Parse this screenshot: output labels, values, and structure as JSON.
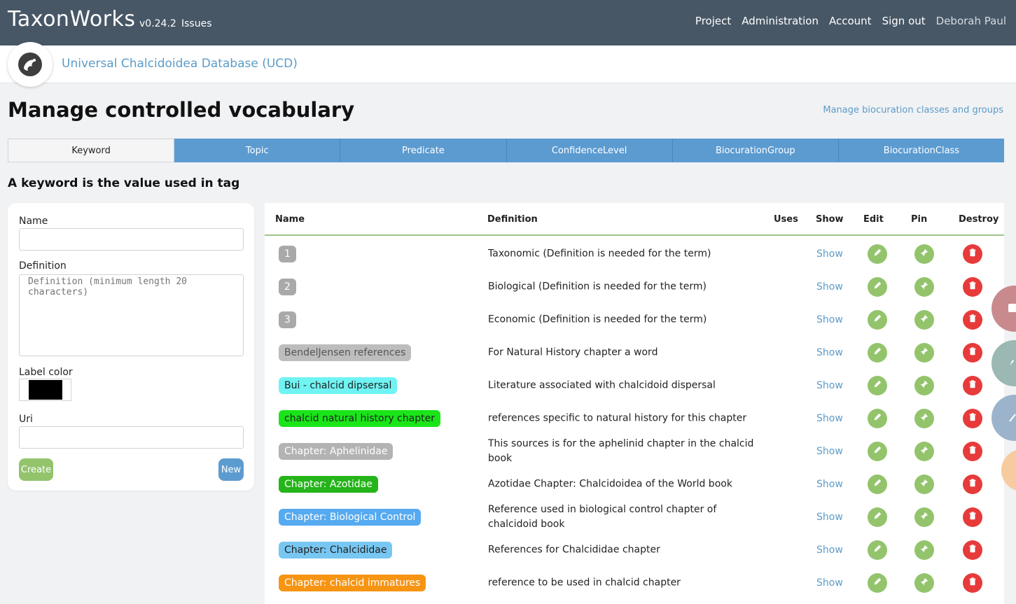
{
  "header": {
    "brand": "TaxonWorks",
    "version": "v0.24.2",
    "issues": "Issues",
    "nav": [
      "Project",
      "Administration",
      "Account",
      "Sign out"
    ],
    "user": "Deborah Paul"
  },
  "project": {
    "name": "Universal Chalcidoidea Database (UCD)"
  },
  "page": {
    "title": "Manage controlled vocabulary",
    "manage_link": "Manage biocuration classes and groups",
    "subtitle": "A keyword is the value used in tag"
  },
  "tabs": [
    "Keyword",
    "Topic",
    "Predicate",
    "ConfidenceLevel",
    "BiocurationGroup",
    "BiocurationClass"
  ],
  "form": {
    "name_label": "Name",
    "definition_label": "Definition",
    "definition_placeholder": "Definition (minimum length 20 characters)",
    "label_color_label": "Label color",
    "label_color": "#000000",
    "uri_label": "Uri",
    "create_label": "Create",
    "new_label": "New"
  },
  "table": {
    "headers": [
      "Name",
      "Definition",
      "Uses",
      "Show",
      "Edit",
      "Pin",
      "Destroy"
    ],
    "show_label": "Show",
    "rows": [
      {
        "name": "1",
        "definition": "Taxonomic (Definition is needed for the term)",
        "bg": "#a9a9a9",
        "fg": "#ffffff"
      },
      {
        "name": "2",
        "definition": "Biological (Definition is needed for the term)",
        "bg": "#a9a9a9",
        "fg": "#ffffff"
      },
      {
        "name": "3",
        "definition": "Economic (Definition is needed for the term)",
        "bg": "#a9a9a9",
        "fg": "#ffffff"
      },
      {
        "name": "BendelJensen references",
        "definition": "For Natural History chapter a word",
        "bg": "#bdbdbd",
        "fg": "#555555"
      },
      {
        "name": "Bui - chalcid dipsersal",
        "definition": "Literature associated with chalcidoid dispersal",
        "bg": "#6ff3f3",
        "fg": "#222222"
      },
      {
        "name": "chalcid natural history chapter",
        "definition": "references specific to natural history for this chapter",
        "bg": "#19e519",
        "fg": "#222222"
      },
      {
        "name": "Chapter: Aphelinidae",
        "definition": "This sources is for the aphelinid chapter in the chalcid book",
        "bg": "#b3b3b3",
        "fg": "#ffffff"
      },
      {
        "name": "Chapter: Azotidae",
        "definition": "Azotidae Chapter: Chalcidoidea of the World book",
        "bg": "#25b41a",
        "fg": "#ffffff"
      },
      {
        "name": "Chapter: Biological Control",
        "definition": "Reference used in biological control chapter of chalcidoid book",
        "bg": "#55aaf0",
        "fg": "#ffffff"
      },
      {
        "name": "Chapter: Chalcididae",
        "definition": "References for Chalcididae chapter",
        "bg": "#77c7f2",
        "fg": "#222222"
      },
      {
        "name": "Chapter: chalcid immatures",
        "definition": "reference to be used in chalcid chapter",
        "bg": "#f79412",
        "fg": "#ffffff"
      }
    ]
  }
}
